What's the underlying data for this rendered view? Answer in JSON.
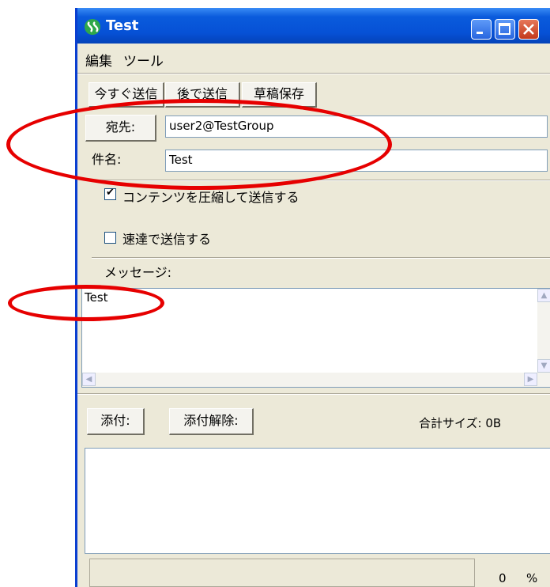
{
  "window": {
    "title": "Test"
  },
  "menu": [
    "編集",
    "ツール"
  ],
  "toolbar": {
    "send_now": "今すぐ送信",
    "send_later": "後で送信",
    "save_draft": "草稿保存"
  },
  "to": {
    "button_label": "宛先:",
    "value": "user2@TestGroup"
  },
  "subject": {
    "label": "件名:",
    "value": "Test"
  },
  "options": {
    "compress_label": "コンテンツを圧縮して送信する",
    "compress_checked": true,
    "express_label": "速達で送信する",
    "express_checked": false
  },
  "message": {
    "label": "メッセージ:",
    "body": "Test"
  },
  "attachments": {
    "attach_button": "添付:",
    "remove_button": "添付解除:",
    "total_size": "合計サイズ: 0B"
  },
  "progress": {
    "value": "0",
    "unit": "%"
  }
}
